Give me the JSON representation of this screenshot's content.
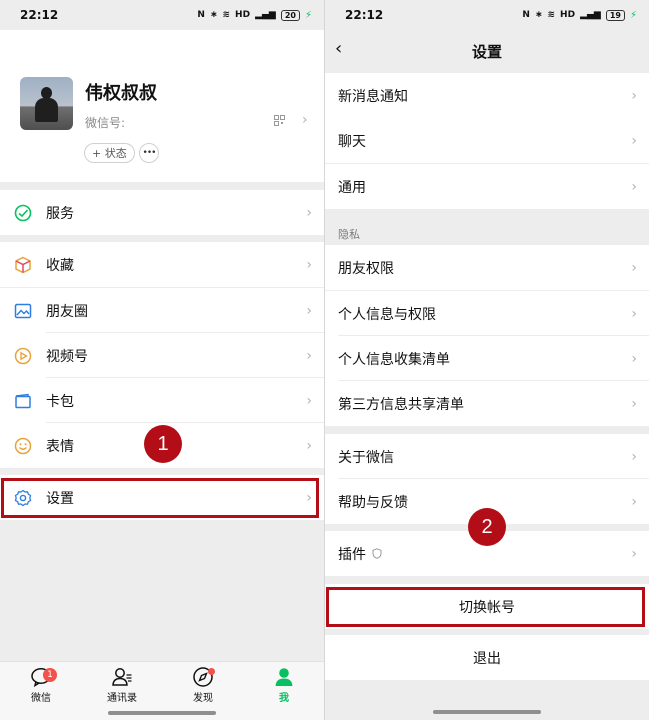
{
  "left": {
    "status": {
      "time": "22:12",
      "battery": "20"
    },
    "profile": {
      "name": "伟权叔叔",
      "wechat_id_label": "微信号:",
      "status_button": "+ 状态",
      "more_button": "•••"
    },
    "menu": {
      "services": "服务",
      "favorites": "收藏",
      "moments": "朋友圈",
      "channels": "视频号",
      "cards": "卡包",
      "stickers": "表情",
      "settings": "设置"
    },
    "tabbar": {
      "chats": "微信",
      "chats_badge": "1",
      "contacts": "通讯录",
      "discover": "发现",
      "me": "我"
    }
  },
  "right": {
    "status": {
      "time": "22:12",
      "battery": "19"
    },
    "header": {
      "back": "‹",
      "title": "设置"
    },
    "items": {
      "notifications": "新消息通知",
      "chat": "聊天",
      "general": "通用",
      "privacy_section": "隐私",
      "friend_permissions": "朋友权限",
      "personal_info_permissions": "个人信息与权限",
      "personal_info_list": "个人信息收集清单",
      "third_party_list": "第三方信息共享清单",
      "about": "关于微信",
      "help": "帮助与反馈",
      "plugins": "插件",
      "switch_account": "切换帐号",
      "logout": "退出"
    }
  },
  "annotations": {
    "step1": "1",
    "step2": "2"
  },
  "colors": {
    "accent_green": "#07c160",
    "highlight_red": "#b30d17",
    "badge_red": "#f2524a"
  }
}
